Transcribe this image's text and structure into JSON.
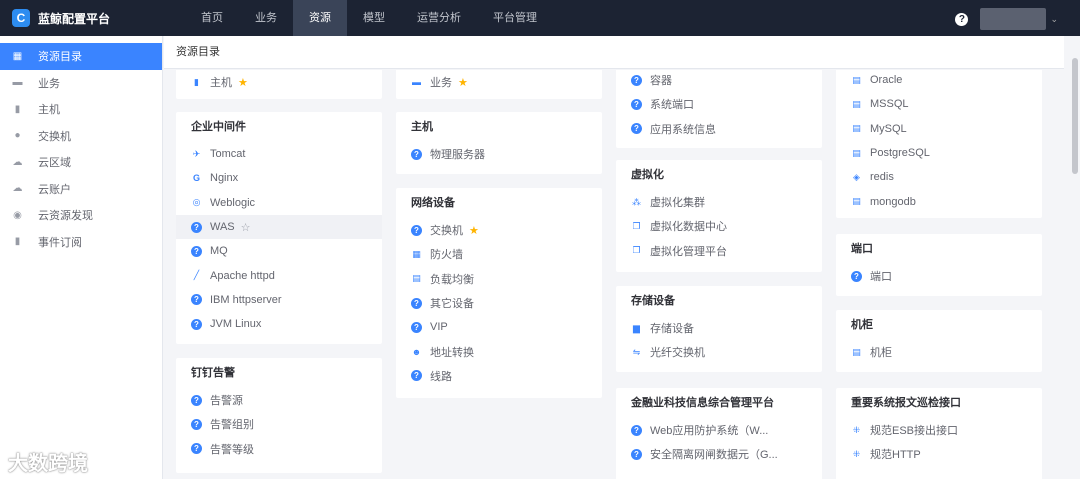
{
  "app": {
    "title": "蓝鲸配置平台",
    "logo_letter": "C"
  },
  "nav": [
    "首页",
    "业务",
    "资源",
    "模型",
    "运营分析",
    "平台管理"
  ],
  "nav_active": "资源",
  "help_label": "?",
  "sidebar": [
    {
      "label": "资源目录",
      "icon": "catalog-icon",
      "glyph": "▦"
    },
    {
      "label": "业务",
      "icon": "business-icon",
      "glyph": "▬"
    },
    {
      "label": "主机",
      "icon": "host-icon",
      "glyph": "▮"
    },
    {
      "label": "交换机",
      "icon": "switch-icon",
      "glyph": "●"
    },
    {
      "label": "云区域",
      "icon": "cloud-area-icon",
      "glyph": "☁"
    },
    {
      "label": "云账户",
      "icon": "cloud-account-icon",
      "glyph": "☁"
    },
    {
      "label": "云资源发现",
      "icon": "discovery-icon",
      "glyph": "◉"
    },
    {
      "label": "事件订阅",
      "icon": "subscribe-icon",
      "glyph": "▮"
    }
  ],
  "breadcrumb": "资源目录",
  "cards": {
    "host_top": {
      "items": [
        {
          "label": "主机",
          "glyph": "▮",
          "star": true
        }
      ]
    },
    "biz_top": {
      "items": [
        {
          "label": "业务",
          "glyph": "▬",
          "star": true
        }
      ]
    },
    "container": {
      "items": [
        {
          "label": "容器"
        },
        {
          "label": "系统端口"
        },
        {
          "label": "应用系统信息"
        }
      ]
    },
    "db": {
      "items": [
        {
          "label": "Oracle",
          "glyph": "▤"
        },
        {
          "label": "MSSQL",
          "glyph": "▤"
        },
        {
          "label": "MySQL",
          "glyph": "▤"
        },
        {
          "label": "PostgreSQL",
          "glyph": "▤"
        },
        {
          "label": "redis",
          "glyph": "◈"
        },
        {
          "label": "mongodb",
          "glyph": "▤"
        }
      ]
    },
    "middleware": {
      "title": "企业中间件",
      "items": [
        {
          "label": "Tomcat",
          "glyph": "✈"
        },
        {
          "label": "Nginx",
          "glyph": "G"
        },
        {
          "label": "Weblogic",
          "glyph": "◎"
        },
        {
          "label": "WAS",
          "star_empty": true
        },
        {
          "label": "MQ"
        },
        {
          "label": "Apache httpd",
          "glyph": "╱"
        },
        {
          "label": "IBM httpserver"
        },
        {
          "label": "JVM Linux"
        }
      ]
    },
    "host": {
      "title": "主机",
      "items": [
        {
          "label": "物理服务器"
        }
      ]
    },
    "virtual": {
      "title": "虚拟化",
      "items": [
        {
          "label": "虚拟化集群",
          "glyph": "⁂"
        },
        {
          "label": "虚拟化数据中心",
          "glyph": "❐"
        },
        {
          "label": "虚拟化管理平台",
          "glyph": "❐"
        }
      ]
    },
    "port": {
      "title": "端口",
      "items": [
        {
          "label": "端口"
        }
      ]
    },
    "network": {
      "title": "网络设备",
      "items": [
        {
          "label": "交换机",
          "star": true
        },
        {
          "label": "防火墙",
          "glyph": "▦"
        },
        {
          "label": "负载均衡",
          "glyph": "▤"
        },
        {
          "label": "其它设备"
        },
        {
          "label": "VIP"
        },
        {
          "label": "地址转换",
          "glyph": "☻"
        },
        {
          "label": "线路"
        }
      ]
    },
    "storage": {
      "title": "存储设备",
      "items": [
        {
          "label": "存储设备",
          "glyph": "▆"
        },
        {
          "label": "光纤交换机",
          "glyph": "⇋"
        }
      ]
    },
    "cabinet": {
      "title": "机柜",
      "items": [
        {
          "label": "机柜",
          "glyph": "▤"
        }
      ]
    },
    "alarm": {
      "title": "钉钉告警",
      "items": [
        {
          "label": "告警源"
        },
        {
          "label": "告警组别"
        },
        {
          "label": "告警等级"
        }
      ]
    },
    "fintech": {
      "title": "金融业科技信息综合管理平台",
      "items": [
        {
          "label": "Web应用防护系统（W..."
        },
        {
          "label": "安全隔离网闸数据元（G..."
        }
      ]
    },
    "esb": {
      "title": "重要系统报文巡检接口",
      "items": [
        {
          "label": "规范ESB接出接口",
          "glyph": "⁜"
        },
        {
          "label": "规范HTTP",
          "glyph": "⁜"
        }
      ]
    }
  },
  "watermark": "大数跨境"
}
